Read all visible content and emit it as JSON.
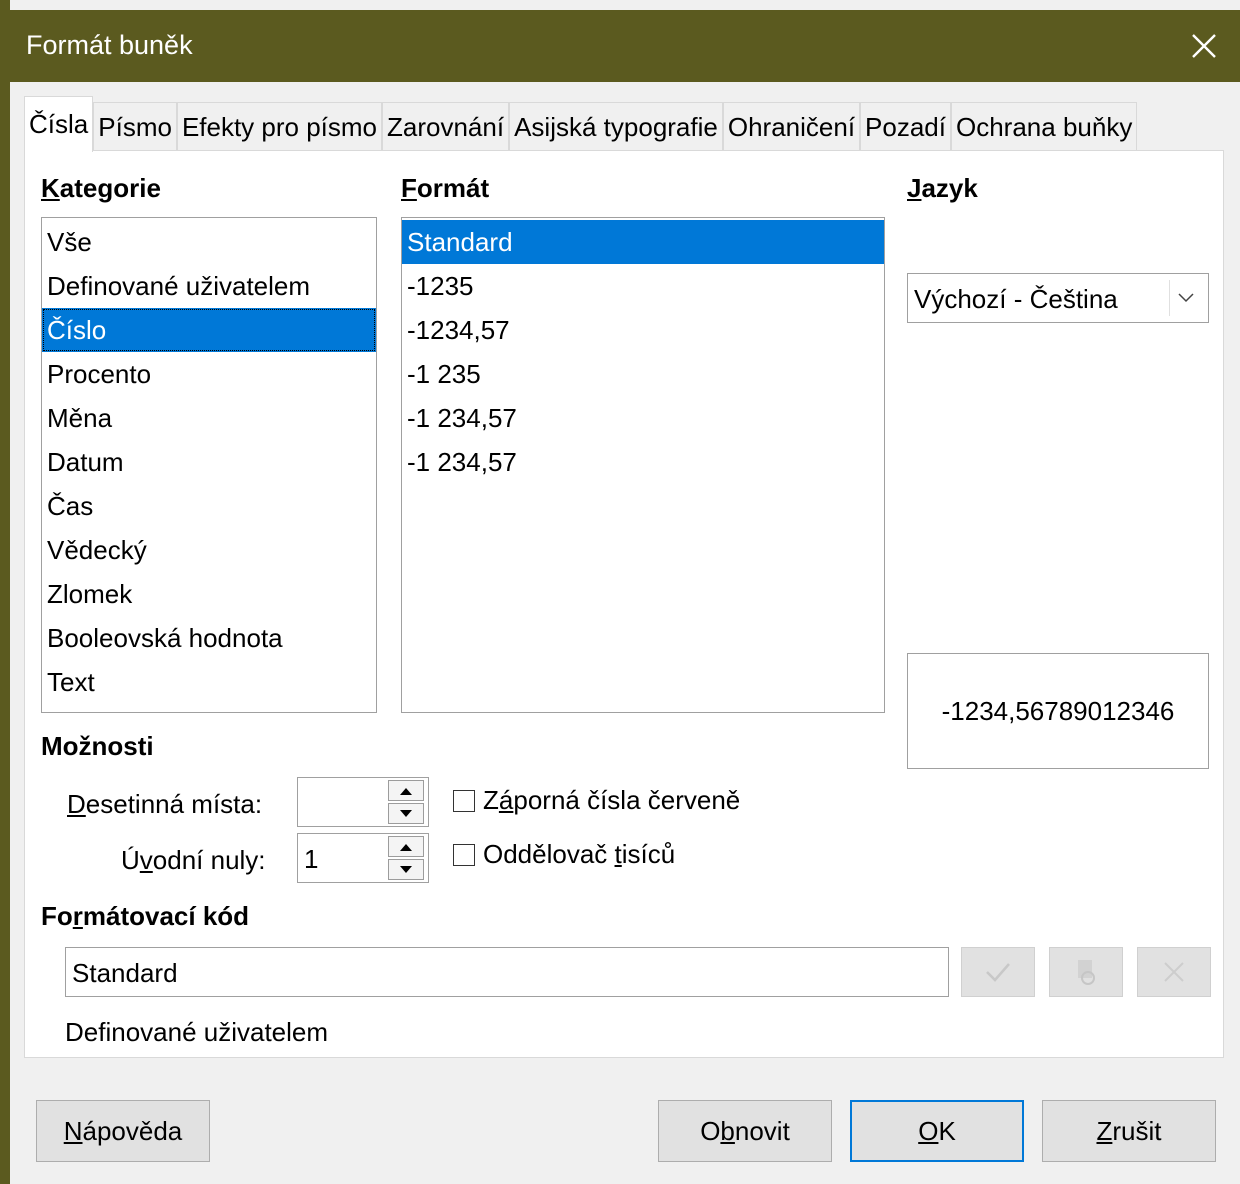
{
  "window": {
    "title": "Formát buněk"
  },
  "tabs": [
    {
      "label": "Čísla",
      "active": true
    },
    {
      "label": "Písmo"
    },
    {
      "label": "Efekty pro písmo"
    },
    {
      "label": "Zarovnání"
    },
    {
      "label": "Asijská typografie"
    },
    {
      "label": "Ohraničení"
    },
    {
      "label": "Pozadí"
    },
    {
      "label": "Ochrana buňky"
    }
  ],
  "category": {
    "label_u": "K",
    "label_rest": "ategorie",
    "items": [
      "Vše",
      "Definované uživatelem",
      "Číslo",
      "Procento",
      "Měna",
      "Datum",
      "Čas",
      "Vědecký",
      "Zlomek",
      "Booleovská hodnota",
      "Text"
    ],
    "selected": "Číslo"
  },
  "format": {
    "label_u": "F",
    "label_rest": "ormát",
    "items": [
      "Standard",
      "-1235",
      "-1234,57",
      "-1 235",
      "-1 234,57",
      "-1 234,57"
    ],
    "selected": "Standard"
  },
  "language": {
    "label_u": "J",
    "label_rest": "azyk",
    "value": "Výchozí - Čeština"
  },
  "preview": {
    "value": "-1234,56789012346"
  },
  "options": {
    "heading": "Možnosti",
    "decimal_label_u": "D",
    "decimal_label_rest": "esetinná místa:",
    "decimal_value": "",
    "leading_label_a": "Ú",
    "leading_label_u": "v",
    "leading_label_b": "odní nuly:",
    "leading_value": "1",
    "negative_red_label_a": "Z",
    "negative_red_label_u": "á",
    "negative_red_label_b": "porná čísla červeně",
    "negative_red_checked": false,
    "thousands_label_a": "Oddělovač ",
    "thousands_label_u": "t",
    "thousands_label_b": "isíců",
    "thousands_checked": false
  },
  "format_code": {
    "heading_a": "Fo",
    "heading_u": "r",
    "heading_b": "mátovací kód",
    "value": "Standard",
    "comment": "Definované uživatelem"
  },
  "buttons": {
    "help_u": "N",
    "help_rest": "ápověda",
    "reset_a": "O",
    "reset_u": "b",
    "reset_b": "novit",
    "ok_u": "O",
    "ok_rest": "K",
    "cancel_u": "Z",
    "cancel_rest": "rušit"
  },
  "colors": {
    "titlebar": "#5b5a1f",
    "selection": "#0078d7"
  }
}
